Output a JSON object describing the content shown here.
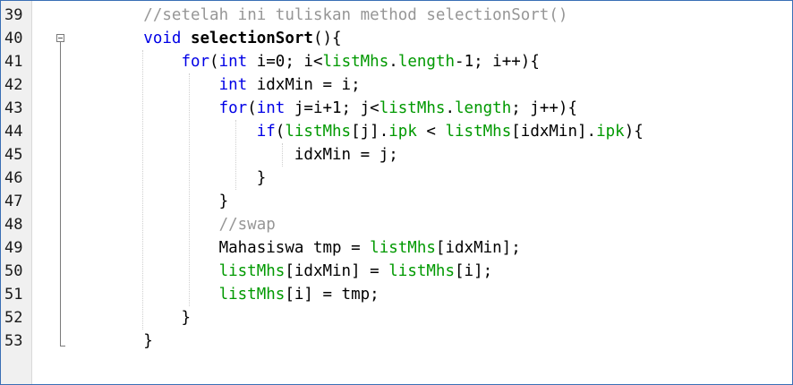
{
  "editor": {
    "lines": [
      {
        "number": "39",
        "indent": "        ",
        "tokens": [
          {
            "t": "//setelah ini tuliskan method selectionSort()",
            "c": "comment"
          }
        ]
      },
      {
        "number": "40",
        "indent": "        ",
        "tokens": [
          {
            "t": "void ",
            "c": "keyword"
          },
          {
            "t": "selectionSort",
            "c": "method"
          },
          {
            "t": "(){",
            "c": "plain"
          }
        ]
      },
      {
        "number": "41",
        "indent": "            ",
        "tokens": [
          {
            "t": "for",
            "c": "keyword"
          },
          {
            "t": "(",
            "c": "plain"
          },
          {
            "t": "int",
            "c": "keyword"
          },
          {
            "t": " i=0; i<",
            "c": "plain"
          },
          {
            "t": "listMhs",
            "c": "field"
          },
          {
            "t": ".",
            "c": "plain"
          },
          {
            "t": "length",
            "c": "field"
          },
          {
            "t": "-1; i++){",
            "c": "plain"
          }
        ]
      },
      {
        "number": "42",
        "indent": "                ",
        "tokens": [
          {
            "t": "int",
            "c": "keyword"
          },
          {
            "t": " idxMin = i;",
            "c": "plain"
          }
        ]
      },
      {
        "number": "43",
        "indent": "                ",
        "tokens": [
          {
            "t": "for",
            "c": "keyword"
          },
          {
            "t": "(",
            "c": "plain"
          },
          {
            "t": "int",
            "c": "keyword"
          },
          {
            "t": " j=i+1; j<",
            "c": "plain"
          },
          {
            "t": "listMhs",
            "c": "field"
          },
          {
            "t": ".",
            "c": "plain"
          },
          {
            "t": "length",
            "c": "field"
          },
          {
            "t": "; j++){",
            "c": "plain"
          }
        ]
      },
      {
        "number": "44",
        "indent": "                    ",
        "tokens": [
          {
            "t": "if",
            "c": "keyword"
          },
          {
            "t": "(",
            "c": "plain"
          },
          {
            "t": "listMhs",
            "c": "field"
          },
          {
            "t": "[j].",
            "c": "plain"
          },
          {
            "t": "ipk",
            "c": "field"
          },
          {
            "t": " < ",
            "c": "plain"
          },
          {
            "t": "listMhs",
            "c": "field"
          },
          {
            "t": "[idxMin].",
            "c": "plain"
          },
          {
            "t": "ipk",
            "c": "field"
          },
          {
            "t": "){",
            "c": "plain"
          }
        ]
      },
      {
        "number": "45",
        "indent": "                        ",
        "tokens": [
          {
            "t": "idxMin = j;",
            "c": "plain"
          }
        ]
      },
      {
        "number": "46",
        "indent": "                    ",
        "tokens": [
          {
            "t": "}",
            "c": "plain"
          }
        ]
      },
      {
        "number": "47",
        "indent": "                ",
        "tokens": [
          {
            "t": "}",
            "c": "plain"
          }
        ]
      },
      {
        "number": "48",
        "indent": "                ",
        "tokens": [
          {
            "t": "//swap",
            "c": "comment"
          }
        ]
      },
      {
        "number": "49",
        "indent": "                ",
        "tokens": [
          {
            "t": "Mahasiswa tmp = ",
            "c": "plain"
          },
          {
            "t": "listMhs",
            "c": "field"
          },
          {
            "t": "[idxMin];",
            "c": "plain"
          }
        ]
      },
      {
        "number": "50",
        "indent": "                ",
        "tokens": [
          {
            "t": "listMhs",
            "c": "field"
          },
          {
            "t": "[idxMin] = ",
            "c": "plain"
          },
          {
            "t": "listMhs",
            "c": "field"
          },
          {
            "t": "[i];",
            "c": "plain"
          }
        ]
      },
      {
        "number": "51",
        "indent": "                ",
        "tokens": [
          {
            "t": "listMhs",
            "c": "field"
          },
          {
            "t": "[i] = tmp;",
            "c": "plain"
          }
        ]
      },
      {
        "number": "52",
        "indent": "            ",
        "tokens": [
          {
            "t": "}",
            "c": "plain"
          }
        ]
      },
      {
        "number": "53",
        "indent": "        ",
        "tokens": [
          {
            "t": "}",
            "c": "plain"
          }
        ]
      }
    ],
    "fold": {
      "collapse_icon": "fold-minus-icon",
      "start_line": "40",
      "end_line": "53"
    },
    "colors": {
      "comment": "#969696",
      "keyword": "#0000e6",
      "field": "#009900",
      "plain": "#000000",
      "border": "#3a6fb5"
    }
  }
}
